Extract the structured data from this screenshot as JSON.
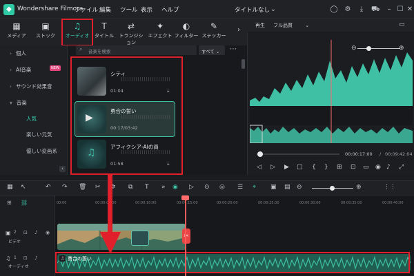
{
  "app": {
    "name": "Wondershare Filmora",
    "doc_title": "タイトルなし"
  },
  "menu": [
    "ファイル",
    "編集",
    "ツール",
    "表示",
    "ヘルプ"
  ],
  "media_tabs": [
    {
      "label": "メディア",
      "icon": "media-icon"
    },
    {
      "label": "ストック",
      "icon": "stock-icon"
    },
    {
      "label": "オーディオ",
      "icon": "music-note-icon",
      "active": true
    },
    {
      "label": "タイトル",
      "icon": "title-icon"
    },
    {
      "label": "トランジション",
      "icon": "transition-icon"
    },
    {
      "label": "エフェクト",
      "icon": "effect-icon"
    },
    {
      "label": "フィルター",
      "icon": "filter-icon"
    },
    {
      "label": "ステッカー",
      "icon": "sticker-icon"
    }
  ],
  "sidebar": {
    "items": [
      {
        "label": "個人"
      },
      {
        "label": "AI音楽",
        "badge": "NEW"
      },
      {
        "label": "サウンド効果音"
      },
      {
        "label": "音楽"
      }
    ],
    "subitems": [
      {
        "label": "人気",
        "active": true
      },
      {
        "label": "楽しい元気"
      },
      {
        "label": "優しい変画系"
      }
    ]
  },
  "search": {
    "placeholder": "音楽を検索",
    "filter": "すべて"
  },
  "assets": [
    {
      "name": "シティ",
      "duration": "01:04",
      "selected": false
    },
    {
      "name": "勇合の誓い",
      "duration": "00:17/03:42",
      "selected": true
    },
    {
      "name": "アフィクシア-AIの員",
      "duration": "01:58",
      "selected": false
    }
  ],
  "preview": {
    "mode": "再生",
    "quality": "フル品質",
    "current_time": "00:00:17:00",
    "total_time": "00:09:42:04"
  },
  "timeline": {
    "ticks": [
      "00:00",
      "00:00:05:00",
      "00:00:10:00",
      "00:00:15:00",
      "00:00:20:00",
      "00:00:25:00",
      "00:00:30:00",
      "00:00:35:00",
      "00:00:40:00"
    ],
    "tracks": [
      {
        "label": "ビデオ",
        "index": "2"
      },
      {
        "label": "オーディオ",
        "index": "1"
      }
    ],
    "audio_clip": "勇合の誓い"
  },
  "colors": {
    "accent": "#39d3b5",
    "highlight_box": "#e0202a",
    "wave": "#3fbfa3"
  }
}
